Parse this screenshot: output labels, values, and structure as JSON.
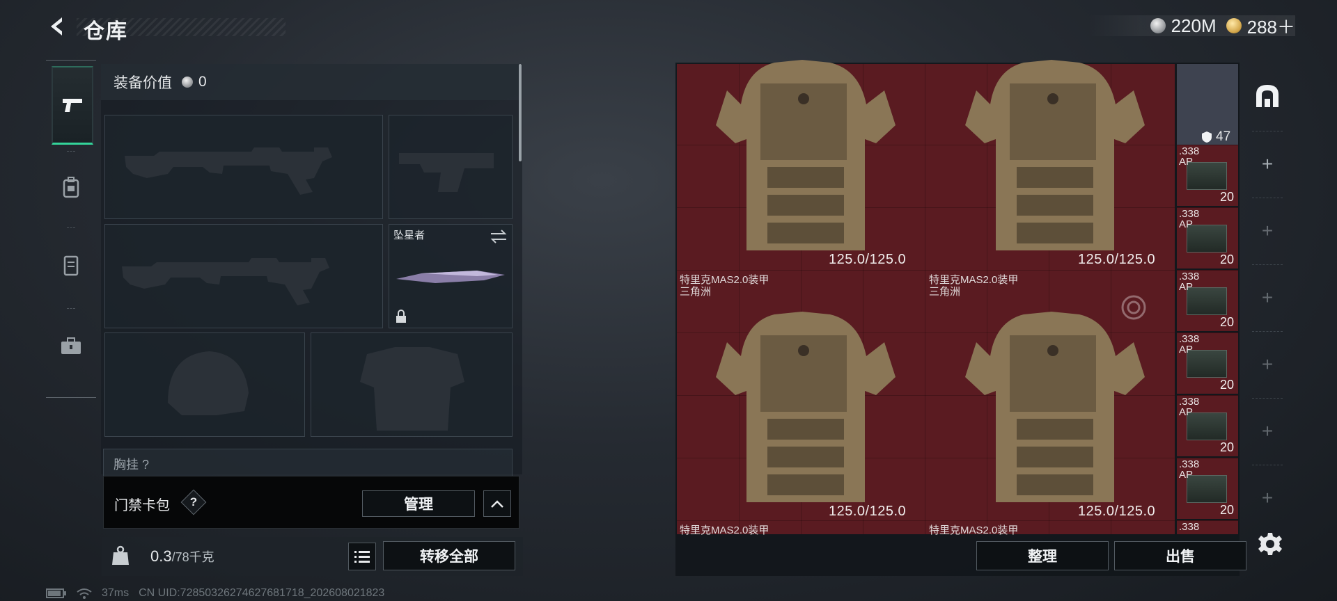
{
  "header": {
    "title": "仓库",
    "back_icon": "back-arrow-icon"
  },
  "currency": [
    {
      "icon": "silver-coin-icon",
      "value": "220M"
    },
    {
      "icon": "gold-coin-icon",
      "value": "288＋"
    }
  ],
  "left_tabs": [
    {
      "name": "weapons",
      "icon": "pistol-icon",
      "active": true
    },
    {
      "name": "gear",
      "icon": "backpack-icon",
      "active": false
    },
    {
      "name": "rig",
      "icon": "vest-icon",
      "active": false
    },
    {
      "name": "supplies",
      "icon": "briefcase-icon",
      "active": false
    }
  ],
  "equipment": {
    "value_label": "装备价值",
    "value": "0",
    "melee_name": "坠星者",
    "chest_rig_label": "胸挂 ?"
  },
  "keycard": {
    "label": "门禁卡包",
    "help": "?",
    "manage": "管理"
  },
  "weight": {
    "current": "0.3",
    "max": "/78千克",
    "icon": "kg-weight-icon",
    "list_icon": "list-icon",
    "transfer_all": "转移全部"
  },
  "status": {
    "battery_icon": "battery-icon",
    "wifi_icon": "wifi-icon",
    "ping": "37ms",
    "uid": "CN UID:7285032627462768171​8_202608021823"
  },
  "storage": {
    "armors": [
      {
        "name": "",
        "sub": "",
        "durability": "125.0/125.0"
      },
      {
        "name": "",
        "sub": "",
        "durability": "125.0/125.0"
      },
      {
        "name": "特里克MAS2.0装甲",
        "sub": "三角洲",
        "durability": "125.0/125.0"
      },
      {
        "name": "特里克MAS2.0装甲",
        "sub": "三角洲",
        "durability": "125.0/125.0"
      }
    ],
    "bottom_row_names": [
      "特里克MAS2.0装甲",
      "特里克MAS2.0装甲"
    ],
    "sliver_durability": "47",
    "ammo": [
      {
        "name": ".338\nAP",
        "count": "20"
      },
      {
        "name": ".338\nAP",
        "count": "20"
      },
      {
        "name": ".338\nAP",
        "count": "20"
      },
      {
        "name": ".338\nAP",
        "count": "20"
      },
      {
        "name": ".338\nAP",
        "count": "20"
      },
      {
        "name": ".338\nAP",
        "count": "20"
      },
      {
        "name": ".338",
        "count": ""
      }
    ]
  },
  "right_bar": {
    "top_icon": "storage-arch-icon",
    "plus": "+",
    "settings_icon": "gear-icon"
  },
  "actions": {
    "sort": "整理",
    "sell": "出售"
  },
  "colors": {
    "accent_green": "#34d49a",
    "grid_red": "#5a1b21"
  }
}
